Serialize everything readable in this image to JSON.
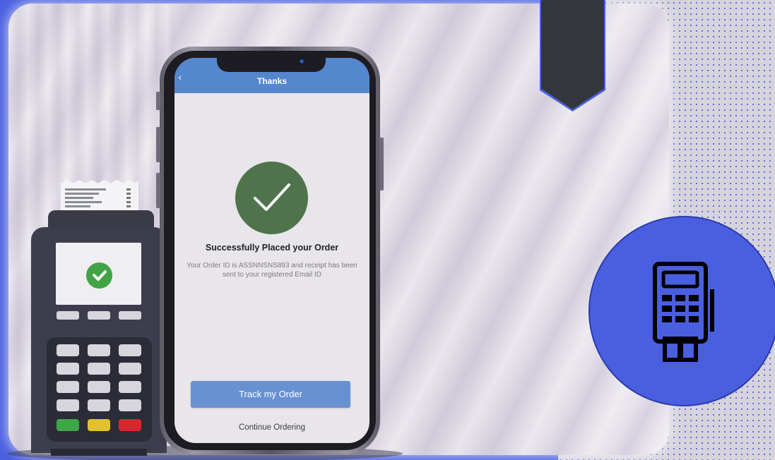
{
  "phone": {
    "appbar": {
      "back_icon": "‹",
      "title": "Thanks"
    },
    "success_icon": "check-circle-icon",
    "success_title": "Successfully Placed your Order",
    "success_message": "Your Order ID is ASSNNSNS893 and receipt has been sent to your registered Email ID",
    "track_button": "Track my Order",
    "continue_link": "Continue Ordering"
  },
  "colors": {
    "brand_blue": "#4a5fe0",
    "appbar_blue": "#5587cf",
    "success_green": "#4f744c",
    "button_blue": "#6891d2",
    "pos_check_green": "#41a345"
  },
  "badge_icon": "pos-terminal-icon",
  "pos_terminal_icon": "card-payment-terminal"
}
